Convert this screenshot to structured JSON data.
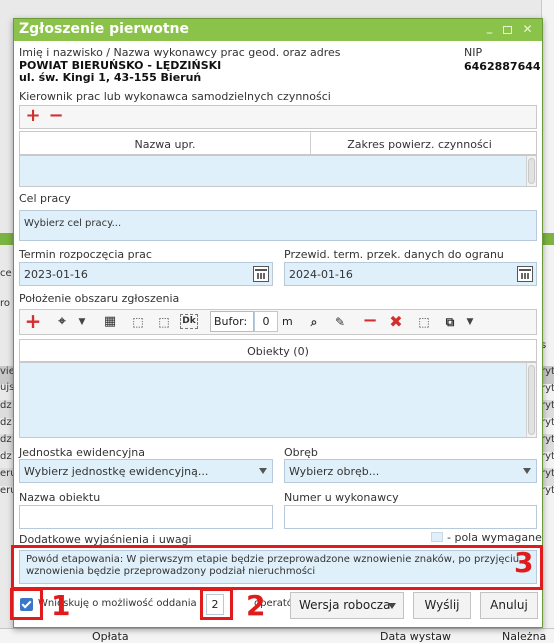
{
  "window": {
    "title": "Zgłoszenie pierwotne"
  },
  "executor": {
    "label": "Imię i nazwisko / Nazwa wykonawcy prac geod. oraz adres",
    "name": "POWIAT BIERUŃSKO - LĘDZIŃSKI",
    "address": "ul. św. Kingi 1, 43-155 Bieruń",
    "nip_label": "NIP",
    "nip_value": "6462887644"
  },
  "manager": {
    "label": "Kierownik prac lub wykonawca samodzielnych czynności",
    "columns": [
      "Nazwa upr.",
      "Zakres powierz. czynności"
    ]
  },
  "purpose": {
    "label": "Cel pracy",
    "placeholder": "Wybierz cel pracy..."
  },
  "dates": {
    "start_label": "Termin rozpoczęcia prac",
    "start_value": "2023-01-16",
    "end_label": "Przewid. term. przek. danych do ogranu",
    "end_value": "2024-01-16"
  },
  "area": {
    "label": "Położenie obszaru zgłoszenia",
    "buffer_label": "Bufor:",
    "buffer_value": "0",
    "buffer_unit": "m",
    "objects_header": "Obiekty (0)"
  },
  "unit": {
    "label": "Jednostka ewidencyjna",
    "placeholder": "Wybierz jednostkę ewidencyjną..."
  },
  "precinct": {
    "label": "Obręb",
    "placeholder": "Wybierz obręb..."
  },
  "object_name": {
    "label": "Nazwa obiektu"
  },
  "executor_number": {
    "label": "Numer u wykonawcy"
  },
  "notes": {
    "label": "Dodatkowe wyjaśnienia i uwagi",
    "required_legend": "- pola wymagane",
    "text": "Powód etapowania: W pierwszym etapie będzie przeprowadzone wznowienie znaków, po przyjęciu wznowienia będzie przeprowadzony podział nieruchmości"
  },
  "footer": {
    "checkbox_text": "Wnioskuję o możliwość oddania",
    "stage_value": "2",
    "stage_suffix": "operatów",
    "version": "Wersja robocza",
    "send": "Wyślij",
    "cancel": "Anuluj"
  },
  "annotations": [
    "1",
    "2",
    "3"
  ],
  "background": {
    "left_rows": [
      "ce",
      "ro",
      "viej",
      "ujs",
      "dz",
      "dz",
      "dz",
      "dz",
      "eru",
      "eru"
    ],
    "right_rows": [
      "s",
      "ryt",
      "ryt",
      "ryt",
      "ryt",
      "ryt",
      "ryt",
      "ryt",
      "ryt"
    ],
    "bottom_cols": [
      "Opłata",
      "Data wystaw",
      "Należna"
    ]
  },
  "colors": {
    "accent": "#8bc34a",
    "field": "#e0f0fa",
    "annotation": "#e01b1b"
  }
}
